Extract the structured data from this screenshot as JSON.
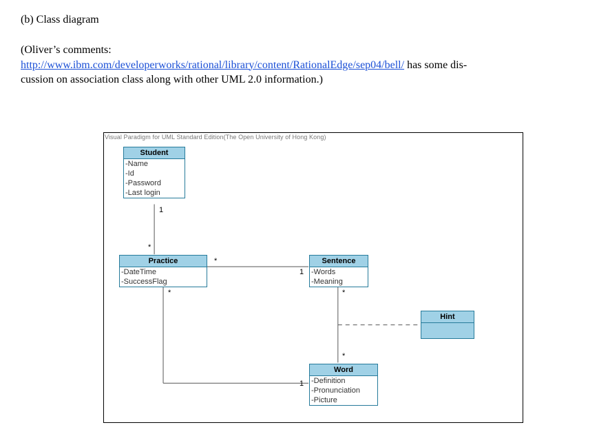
{
  "heading": "(b)  Class diagram",
  "comment": {
    "prefix": "(Oliver’s comments:",
    "link_text": "http://www.ibm.com/developerworks/rational/library/content/RationalEdge/sep04/bell/",
    "after_link": " has some dis-",
    "line3": "cussion on association class along with other UML 2.0 information.)"
  },
  "watermark": "Visual Paradigm for UML Standard Edition(The Open University of Hong Kong)",
  "classes": {
    "student": {
      "name": "Student",
      "attrs": [
        "-Name",
        "-Id",
        "-Password",
        "-Last login"
      ]
    },
    "practice": {
      "name": "Practice",
      "attrs": [
        "-DateTime",
        "-SuccessFlag"
      ]
    },
    "sentence": {
      "name": "Sentence",
      "attrs": [
        "-Words",
        "-Meaning"
      ]
    },
    "word": {
      "name": "Word",
      "attrs": [
        "-Definition",
        "-Pronunciation",
        "-Picture"
      ]
    },
    "hint": {
      "name": "Hint"
    }
  },
  "mult": {
    "student_bottom": "1",
    "practice_top": "*",
    "practice_right_star": "*",
    "practice_bottom_star": "*",
    "sentence_left_one": "1",
    "sentence_bottom_star": "*",
    "word_top_star": "*",
    "word_left_one": "1"
  }
}
